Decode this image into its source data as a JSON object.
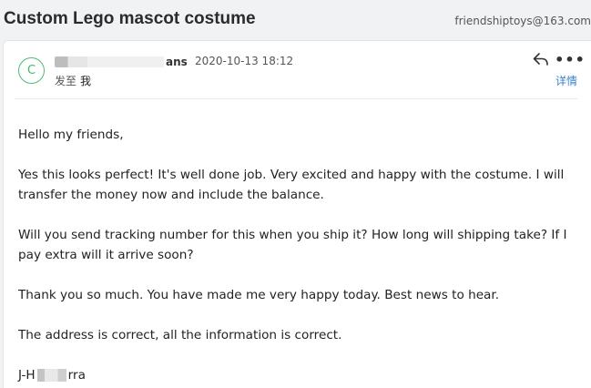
{
  "header": {
    "subject": "Custom Lego mascot costume",
    "mailbox": "friendshiptoys@163.com"
  },
  "message": {
    "avatar_letter": "C",
    "sender_name_suffix": "ans",
    "date": "2020-10-13 18:12",
    "to_label": "发至",
    "to_value": "我",
    "details_label": "详情",
    "more_label": "•••",
    "reply_icon": "reply-icon",
    "avatar_color": "#3fb765",
    "link_color": "#3b82c9"
  },
  "body": {
    "greeting": "Hello my friends,",
    "paragraph1": "Yes this looks perfect! It's well done job. Very excited and happy with the costume. I will transfer the money now and include the balance.",
    "paragraph2": "Will you send tracking number for this when you ship it? How long will shipping take? If I pay extra will it arrive soon?",
    "paragraph3": "Thank you so much. You have made me very happy today. Best news to hear.",
    "paragraph4": "The address is correct, all the information is correct.",
    "signature_start": "J-H",
    "signature_end": "rra"
  }
}
